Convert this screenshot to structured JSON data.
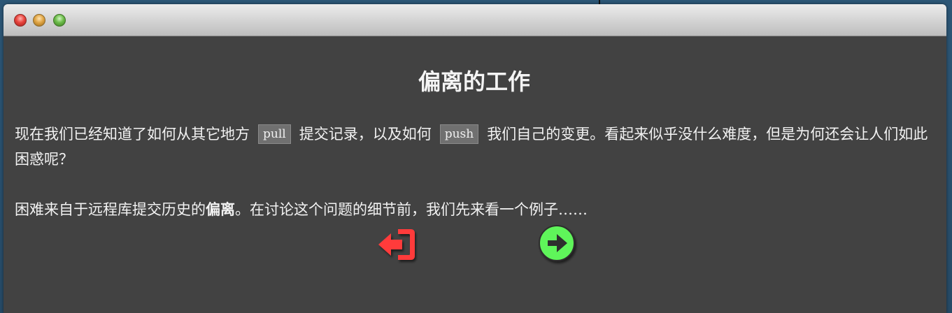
{
  "dialog": {
    "title": "偏离的工作",
    "paragraph1": {
      "part1": "现在我们已经知道了如何从其它地方",
      "code1": "pull",
      "part2": "提交记录，以及如何",
      "code2": "push",
      "part3": "我们自己的变更。看起来似乎没什么难度，但是为何还会让人们如此困惑呢？"
    },
    "paragraph2": {
      "part1": "困难来自于远程库提交历史的",
      "bold": "偏离",
      "part2": "。在讨论这个问题的细节前，我们先来看一个例子……"
    }
  },
  "icons": {
    "back": "exit-icon",
    "next": "arrow-right-circle-icon"
  },
  "colors": {
    "back_icon": "#ff3b3b",
    "next_icon": "#5ff55a",
    "window_bg": "#424242"
  }
}
